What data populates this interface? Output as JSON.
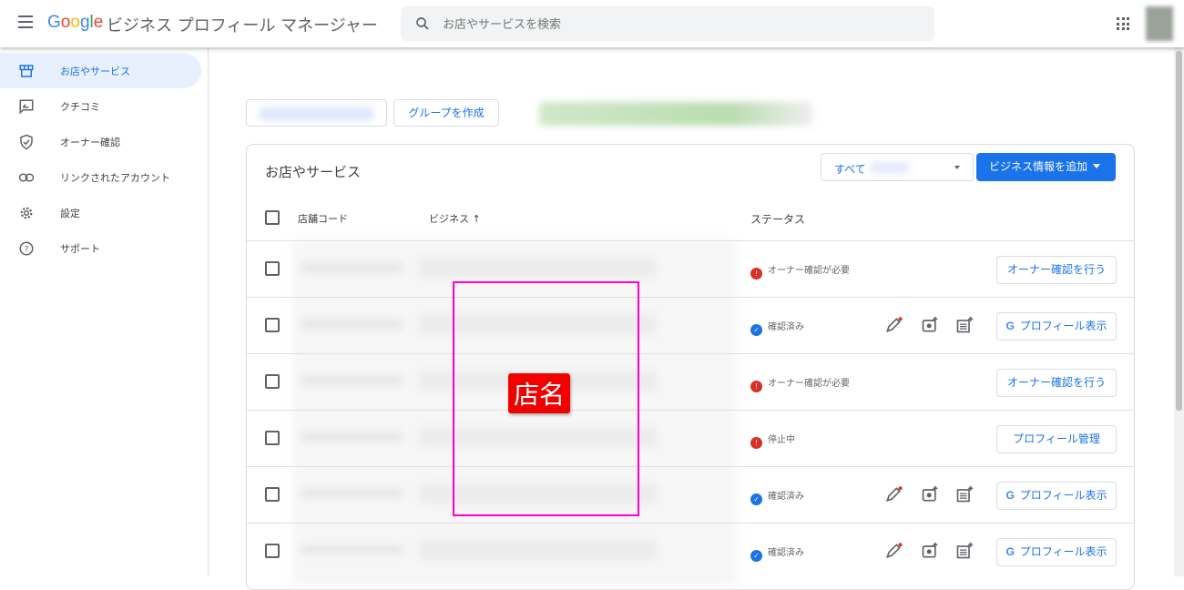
{
  "header": {
    "logo": [
      "G",
      "o",
      "o",
      "g",
      "l",
      "e"
    ],
    "title": "ビジネス プロフィール マネージャー",
    "search_placeholder": "お店やサービスを検索"
  },
  "sidebar": {
    "items": [
      {
        "label": "お店やサービス",
        "icon": "store-icon",
        "active": true
      },
      {
        "label": "クチコミ",
        "icon": "review-icon"
      },
      {
        "label": "オーナー確認",
        "icon": "shield-check-icon"
      },
      {
        "label": "リンクされたアカウント",
        "icon": "link-icon"
      },
      {
        "label": "設定",
        "icon": "gear-icon"
      },
      {
        "label": "サポート",
        "icon": "help-icon"
      }
    ]
  },
  "toolbar": {
    "create_group": "グループを作成"
  },
  "card": {
    "title": "お店やサービス",
    "filter_value": "すべて",
    "add_business": "ビジネス情報を追加",
    "columns": {
      "code": "店舗コード",
      "business": "ビジネス",
      "status": "ステータス"
    }
  },
  "rows": [
    {
      "status": "オーナー確認が必要",
      "type": "warn",
      "action": "オーナー確認を行う"
    },
    {
      "status": "確認済み",
      "type": "ok",
      "action": "プロフィール表示"
    },
    {
      "status": "オーナー確認が必要",
      "type": "warn",
      "action": "オーナー確認を行う"
    },
    {
      "status": "停止中",
      "type": "warn",
      "action": "プロフィール管理"
    },
    {
      "status": "確認済み",
      "type": "ok",
      "action": "プロフィール表示"
    },
    {
      "status": "確認済み",
      "type": "ok",
      "action": "プロフィール表示"
    }
  ],
  "annotation": {
    "label": "店名"
  },
  "colors": {
    "accent": "#1a73e8",
    "warn": "#d93025",
    "highlight": "#ff00cc",
    "label": "#f20000"
  }
}
